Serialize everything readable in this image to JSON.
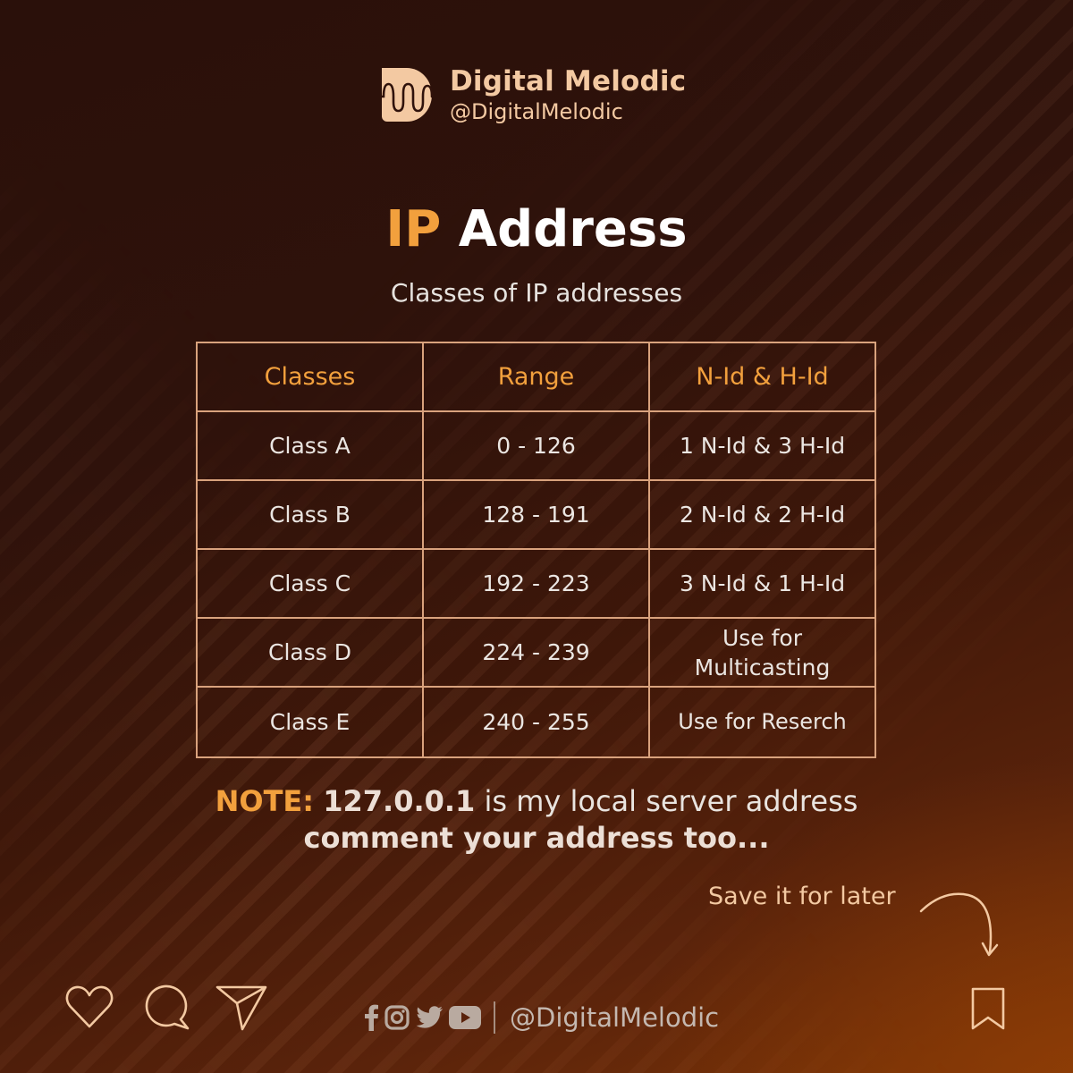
{
  "brand": {
    "name": "Digital Melodic",
    "handle": "@DigitalMelodic",
    "logo_icon": "waveform-d-logo"
  },
  "header": {
    "title_accent": "IP",
    "title_rest": "Address",
    "subtitle": "Classes of IP addresses"
  },
  "table": {
    "headers": [
      "Classes",
      "Range",
      "N-Id & H-Id"
    ],
    "rows": [
      [
        "Class A",
        "0 - 126",
        "1 N-Id & 3 H-Id"
      ],
      [
        "Class B",
        "128 - 191",
        "2 N-Id & 2 H-Id"
      ],
      [
        "Class C",
        "192 - 223",
        "3 N-Id & 1 H-Id"
      ],
      [
        "Class D",
        "224 - 239",
        "Use for Multicasting"
      ],
      [
        "Class E",
        "240 - 255",
        "Use for Reserch"
      ]
    ]
  },
  "note": {
    "label": "NOTE:",
    "ip": "127.0.0.1",
    "text": " is my local server address",
    "line2": "comment your address too..."
  },
  "save": {
    "label": "Save it for later",
    "arrow_icon": "curved-arrow-down-icon"
  },
  "actions": {
    "like_icon": "heart-icon",
    "comment_icon": "speech-bubble-icon",
    "share_icon": "paper-plane-icon",
    "bookmark_icon": "bookmark-icon"
  },
  "footer": {
    "social_icons": [
      "facebook-icon",
      "instagram-icon",
      "twitter-icon",
      "youtube-icon"
    ],
    "handle": "@DigitalMelodic"
  },
  "colors": {
    "accent": "#f2a03d",
    "brand": "#f3c9a2",
    "table_border": "#d9a27d",
    "bg_dark": "#2a100a",
    "bg_glow": "#7a3306"
  }
}
